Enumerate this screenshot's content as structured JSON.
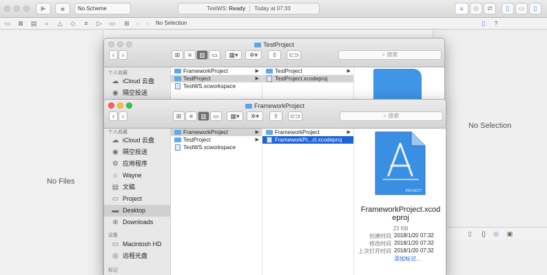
{
  "xcode": {
    "scheme": "No Scheme",
    "status_project": "TestWS:",
    "status_state": "Ready",
    "status_time": "Today at 07:33",
    "nav_path": "No Selection",
    "left_empty": "No Files",
    "right_empty": "No Selection"
  },
  "finder_back": {
    "title": "TestProject",
    "search_placeholder": "搜索",
    "sidebar": {
      "favorites_header": "个人收藏",
      "items": [
        "iCloud 云盘",
        "隔空投送"
      ]
    },
    "col1": [
      "FrameworkProject",
      "TestProject",
      "TestWS.xcworkspace"
    ],
    "col2": [
      "TestProject",
      "TestProject.xcodeproj"
    ]
  },
  "finder_front": {
    "title": "FrameworkProject",
    "search_placeholder": "搜索",
    "sidebar": {
      "favorites_header": "个人收藏",
      "favorites": [
        "iCloud 云盘",
        "隔空投送",
        "应用程序",
        "Wayne",
        "文稿",
        "Project",
        "Desktop",
        "Downloads"
      ],
      "devices_header": "设备",
      "devices": [
        "Macintosh HD",
        "远程光盘"
      ],
      "tags_header": "标记"
    },
    "col1": [
      "FrameworkProject",
      "TestProject",
      "TestWS.xcworkspace"
    ],
    "col2": [
      "FrameworkProject",
      "FrameworkPr...ct.xcodeproj"
    ],
    "preview": {
      "icon_caption": "PROJECT",
      "name_line1": "FrameworkProject.xcod",
      "name_line2": "eproj",
      "size": "23 KB",
      "created_label": "创建时间",
      "created": "2018/1/20 07:32",
      "modified_label": "修改时间",
      "modified": "2018/1/20 07:32",
      "opened_label": "上次打开时间",
      "opened": "2018/1/20 07:32",
      "add_tags": "添加标记..."
    }
  }
}
